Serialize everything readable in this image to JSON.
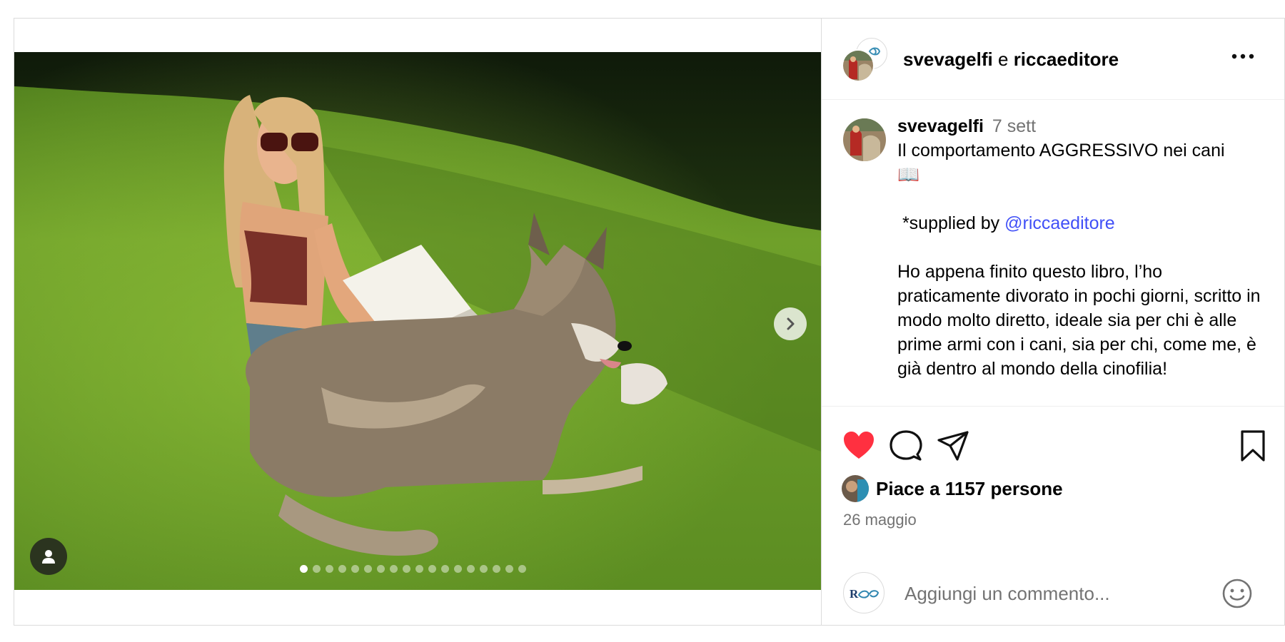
{
  "header": {
    "user1": "svevagelfi",
    "conjunction": "e",
    "user2": "riccaeditore"
  },
  "caption": {
    "username": "svevagelfi",
    "time": "7 sett",
    "line1": "Il comportamento AGGRESSIVO nei cani",
    "emoji": "📖",
    "supplied_prefix": " *supplied by ",
    "mention": "@riccaeditore",
    "paragraph": "Ho appena finito questo libro, l’ho praticamente divorato in pochi giorni, scritto in modo molto diretto, ideale sia per chi è alle prime armi con i cani, sia per chi, come me, è già dentro al mondo della cinofilia!"
  },
  "likes": {
    "text": "Piace a 1157 persone"
  },
  "date": "26 maggio",
  "comment": {
    "placeholder": "Aggiungi un commento..."
  },
  "carousel": {
    "total_slides": 18,
    "current_slide": 1
  },
  "colors": {
    "like_red": "#ff3040",
    "mention_blue": "#4150f7",
    "muted_gray": "#737373",
    "border": "#dbdbdb"
  },
  "icons": {
    "like": "heart-icon",
    "comment": "comment-bubble-icon",
    "share": "paper-plane-icon",
    "save": "bookmark-icon",
    "more": "more-dots-icon",
    "next": "chevron-right-icon",
    "tag": "user-tag-icon",
    "emoji": "smiley-icon"
  }
}
